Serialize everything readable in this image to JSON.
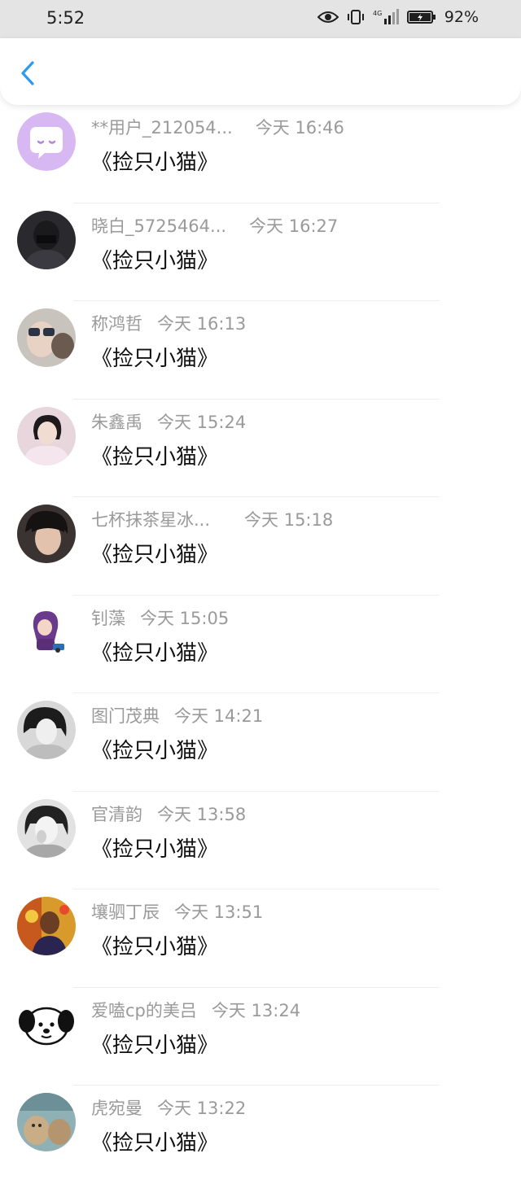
{
  "status_bar": {
    "time": "5:52",
    "network": "4G",
    "battery": "92%"
  },
  "nav": {
    "back_icon": "chevron-left-icon",
    "accent_color": "#2b9af3"
  },
  "items": [
    {
      "name": "**用户_212054...",
      "time": "今天 16:46",
      "message": "《捡只小猫》",
      "avatar": "chat-bubble-avatar"
    },
    {
      "name": "晓白_5725464...",
      "time": "今天 16:27",
      "message": "《捡只小猫》",
      "avatar": "user-photo"
    },
    {
      "name": "称鸿哲",
      "time": "今天 16:13",
      "message": "《捡只小猫》",
      "avatar": "user-photo"
    },
    {
      "name": "朱鑫禹",
      "time": "今天 15:24",
      "message": "《捡只小猫》",
      "avatar": "user-photo"
    },
    {
      "name": "七杯抹茶星冰...",
      "time": "今天 15:18",
      "message": "《捡只小猫》",
      "avatar": "user-photo"
    },
    {
      "name": "钊藻",
      "time": "今天 15:05",
      "message": "《捡只小猫》",
      "avatar": "cartoon-character"
    },
    {
      "name": "图门茂典",
      "time": "今天 14:21",
      "message": "《捡只小猫》",
      "avatar": "user-photo"
    },
    {
      "name": "官清韵",
      "time": "今天 13:58",
      "message": "《捡只小猫》",
      "avatar": "user-photo"
    },
    {
      "name": "壤驷丁辰",
      "time": "今天 13:51",
      "message": "《捡只小猫》",
      "avatar": "user-photo"
    },
    {
      "name": "爱嗑cp的美吕",
      "time": "今天 13:24",
      "message": "《捡只小猫》",
      "avatar": "cartoon-dog"
    },
    {
      "name": "虎宛曼",
      "time": "今天 13:22",
      "message": "《捡只小猫》",
      "avatar": "user-photo"
    }
  ]
}
